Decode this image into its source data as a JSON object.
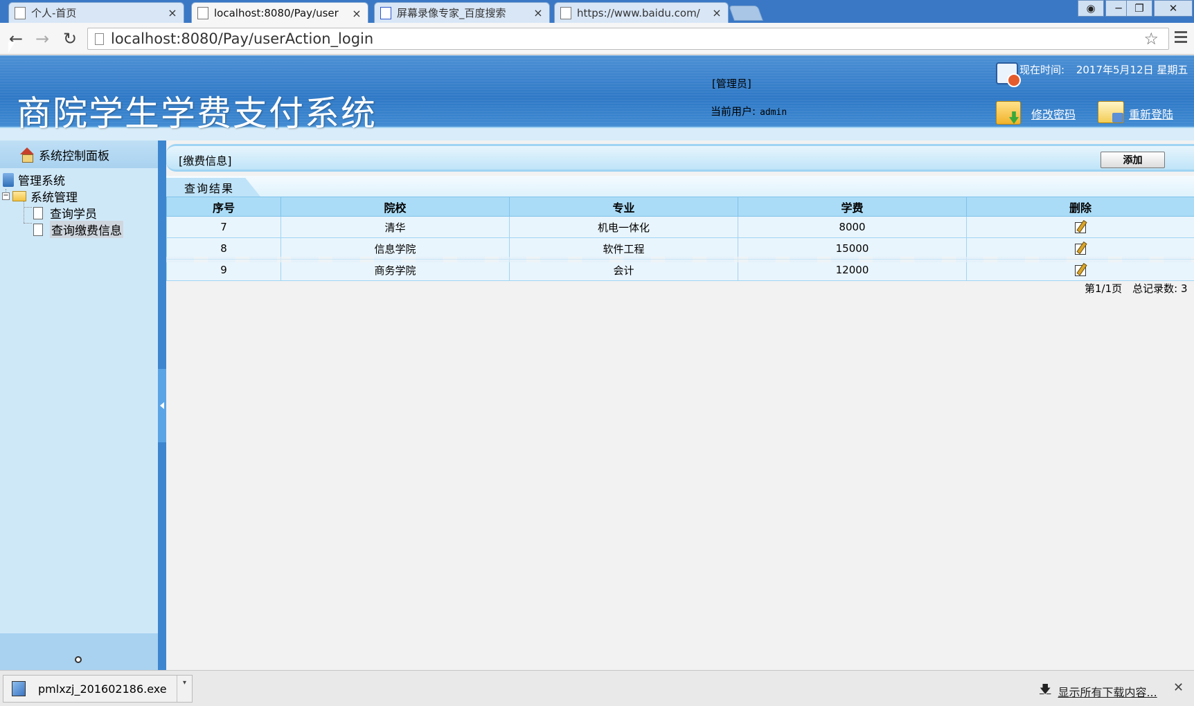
{
  "browser": {
    "tabs": [
      {
        "title": "个人-首页",
        "active": false
      },
      {
        "title": "localhost:8080/Pay/user",
        "active": true
      },
      {
        "title": "屏幕录像专家_百度搜索",
        "active": false
      },
      {
        "title": "https://www.baidu.com/",
        "active": false
      }
    ],
    "close_glyph": "×",
    "url": "localhost:8080/Pay/userAction_login"
  },
  "header": {
    "app_title": "商院学生学费支付系统",
    "role": "[管理员]",
    "current_user_label": "当前用户:",
    "current_user": "admin",
    "time_label": "现在时间:",
    "time_value": "2017年5月12日 星期五",
    "change_password": "修改密码",
    "relogin": "重新登陆"
  },
  "sidebar": {
    "title": "系统控制面板",
    "tree": {
      "root": "管理系统",
      "group": "系统管理",
      "items": [
        "查询学员",
        "查询缴费信息"
      ],
      "selected_index": 1
    }
  },
  "content": {
    "bar_title": "[缴费信息]",
    "add_button": "添加",
    "tab_label": "查询结果",
    "table": {
      "columns": [
        "序号",
        "院校",
        "专业",
        "学费",
        "删除"
      ],
      "rows": [
        {
          "id": "7",
          "school": "清华",
          "major": "机电一体化",
          "fee": "8000"
        },
        {
          "id": "8",
          "school": "信息学院",
          "major": "软件工程",
          "fee": "15000"
        },
        {
          "id": "9",
          "school": "商务学院",
          "major": "会计",
          "fee": "12000"
        }
      ]
    },
    "pager": "第1/1页　总记录数: 3"
  },
  "downloads": {
    "file": "pmlxzj_201602186.exe",
    "show_all": "显示所有下载内容..."
  }
}
